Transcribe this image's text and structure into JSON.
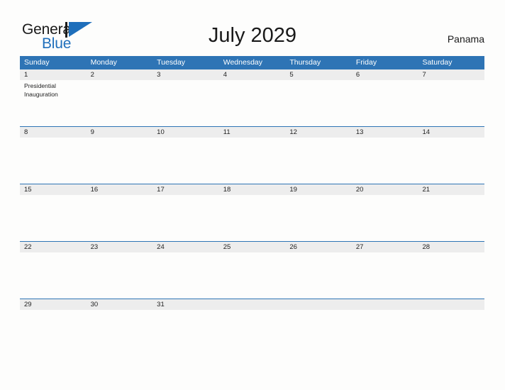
{
  "brand": {
    "name_part1": "General",
    "name_part2": "Blue",
    "color_dark": "#1a1a1a",
    "color_blue": "#1f6fbb"
  },
  "header": {
    "title": "July 2029",
    "country": "Panama"
  },
  "theme": {
    "header_blue": "#2e74b5",
    "date_band_gray": "#ededed",
    "page_background": "#fdfdfc",
    "text_dark": "#1a1a1a"
  },
  "calendar": {
    "month": "July",
    "year": "2029",
    "day_headers": [
      "Sunday",
      "Monday",
      "Tuesday",
      "Wednesday",
      "Thursday",
      "Friday",
      "Saturday"
    ],
    "weeks": [
      {
        "days": [
          {
            "date": "1",
            "events": [
              "Presidential Inauguration"
            ]
          },
          {
            "date": "2",
            "events": []
          },
          {
            "date": "3",
            "events": []
          },
          {
            "date": "4",
            "events": []
          },
          {
            "date": "5",
            "events": []
          },
          {
            "date": "6",
            "events": []
          },
          {
            "date": "7",
            "events": []
          }
        ]
      },
      {
        "days": [
          {
            "date": "8",
            "events": []
          },
          {
            "date": "9",
            "events": []
          },
          {
            "date": "10",
            "events": []
          },
          {
            "date": "11",
            "events": []
          },
          {
            "date": "12",
            "events": []
          },
          {
            "date": "13",
            "events": []
          },
          {
            "date": "14",
            "events": []
          }
        ]
      },
      {
        "days": [
          {
            "date": "15",
            "events": []
          },
          {
            "date": "16",
            "events": []
          },
          {
            "date": "17",
            "events": []
          },
          {
            "date": "18",
            "events": []
          },
          {
            "date": "19",
            "events": []
          },
          {
            "date": "20",
            "events": []
          },
          {
            "date": "21",
            "events": []
          }
        ]
      },
      {
        "days": [
          {
            "date": "22",
            "events": []
          },
          {
            "date": "23",
            "events": []
          },
          {
            "date": "24",
            "events": []
          },
          {
            "date": "25",
            "events": []
          },
          {
            "date": "26",
            "events": []
          },
          {
            "date": "27",
            "events": []
          },
          {
            "date": "28",
            "events": []
          }
        ]
      },
      {
        "days": [
          {
            "date": "29",
            "events": []
          },
          {
            "date": "30",
            "events": []
          },
          {
            "date": "31",
            "events": []
          },
          {
            "date": "",
            "events": []
          },
          {
            "date": "",
            "events": []
          },
          {
            "date": "",
            "events": []
          },
          {
            "date": "",
            "events": []
          }
        ]
      }
    ]
  }
}
